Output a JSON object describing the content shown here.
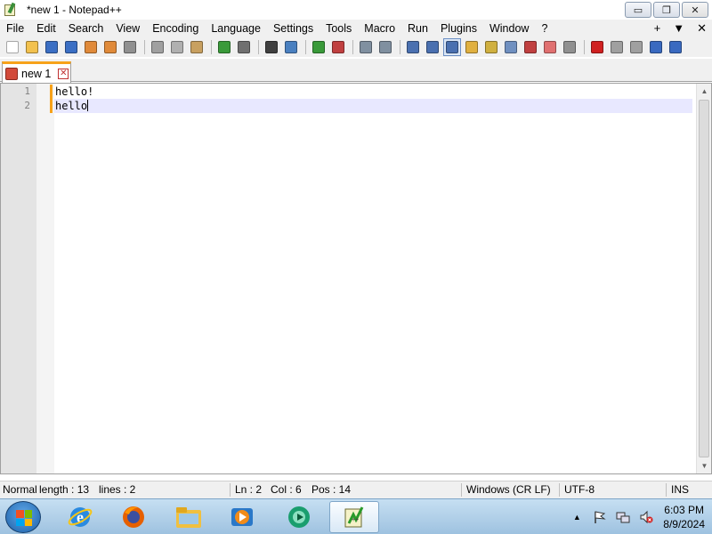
{
  "window": {
    "title": "*new 1 - Notepad++",
    "min_glyph": "▭",
    "max_glyph": "❐",
    "close_glyph": "✕"
  },
  "menu": {
    "items": [
      "File",
      "Edit",
      "Search",
      "View",
      "Encoding",
      "Language",
      "Settings",
      "Tools",
      "Macro",
      "Run",
      "Plugins",
      "Window",
      "?"
    ],
    "right": [
      "+",
      "▼",
      "✕"
    ]
  },
  "toolbar": {
    "buttons": [
      {
        "name": "new-file-icon",
        "color": "#ffffff"
      },
      {
        "name": "open-file-icon",
        "color": "#f2c14e"
      },
      {
        "name": "save-icon",
        "color": "#3b6fc4"
      },
      {
        "name": "save-all-icon",
        "color": "#3b6fc4"
      },
      {
        "name": "close-icon",
        "color": "#e08a3a"
      },
      {
        "name": "close-all-icon",
        "color": "#e08a3a"
      },
      {
        "name": "print-icon",
        "color": "#909090"
      },
      {
        "sep": true
      },
      {
        "name": "cut-icon",
        "color": "#a0a0a0"
      },
      {
        "name": "copy-icon",
        "color": "#b0b0b0"
      },
      {
        "name": "paste-icon",
        "color": "#c8a060"
      },
      {
        "sep": true
      },
      {
        "name": "undo-icon",
        "color": "#3a9a3a"
      },
      {
        "name": "redo-icon",
        "color": "#707070"
      },
      {
        "sep": true
      },
      {
        "name": "find-icon",
        "color": "#404040"
      },
      {
        "name": "replace-icon",
        "color": "#4a80c0"
      },
      {
        "sep": true
      },
      {
        "name": "zoom-in-icon",
        "color": "#3a9a3a"
      },
      {
        "name": "zoom-out-icon",
        "color": "#c04040"
      },
      {
        "sep": true
      },
      {
        "name": "sync-vertical-icon",
        "color": "#8090a0"
      },
      {
        "name": "sync-horizontal-icon",
        "color": "#8090a0"
      },
      {
        "sep": true
      },
      {
        "name": "word-wrap-icon",
        "color": "#4a70b0"
      },
      {
        "name": "show-all-chars-icon",
        "color": "#4a70b0"
      },
      {
        "name": "indent-guide-icon",
        "color": "#4a70b0",
        "active": true
      },
      {
        "name": "doc-map-icon",
        "color": "#e0b040"
      },
      {
        "name": "function-list-icon",
        "color": "#d0b040"
      },
      {
        "name": "folder-workspace-icon",
        "color": "#7090c0"
      },
      {
        "name": "monitoring-icon",
        "color": "#c04040"
      },
      {
        "name": "folder-as-workspace-icon",
        "color": "#e07070"
      },
      {
        "name": "record-placeholder-icon",
        "color": "#909090"
      },
      {
        "sep": true
      },
      {
        "name": "macro-record-icon",
        "color": "#d02020"
      },
      {
        "name": "macro-stop-icon",
        "color": "#a0a0a0"
      },
      {
        "name": "macro-play-icon",
        "color": "#a0a0a0"
      },
      {
        "name": "macro-play-multiple-icon",
        "color": "#3a6ac0"
      },
      {
        "name": "macro-save-icon",
        "color": "#3a6ac0"
      }
    ]
  },
  "tabs": [
    {
      "label": "new 1",
      "close_glyph": "✕"
    }
  ],
  "editor": {
    "lines": [
      {
        "number": "1",
        "text": "hello!"
      },
      {
        "number": "2",
        "text": "hello"
      }
    ],
    "scroll_up": "▲",
    "scroll_down": "▼"
  },
  "status": {
    "lang": "Normal text file",
    "length": "length : 13",
    "lines": "lines : 2",
    "ln": "Ln : 2",
    "col": "Col : 6",
    "pos": "Pos : 14",
    "eol": "Windows (CR LF)",
    "encoding": "UTF-8",
    "mode": "INS"
  },
  "taskbar": {
    "apps": [
      "internet-explorer-icon",
      "firefox-icon",
      "file-explorer-icon",
      "media-player-icon",
      "media-center-icon",
      "notepad-plus-plus-icon"
    ],
    "tray_up": "▲",
    "time": "6:03 PM",
    "date": "8/9/2024"
  }
}
